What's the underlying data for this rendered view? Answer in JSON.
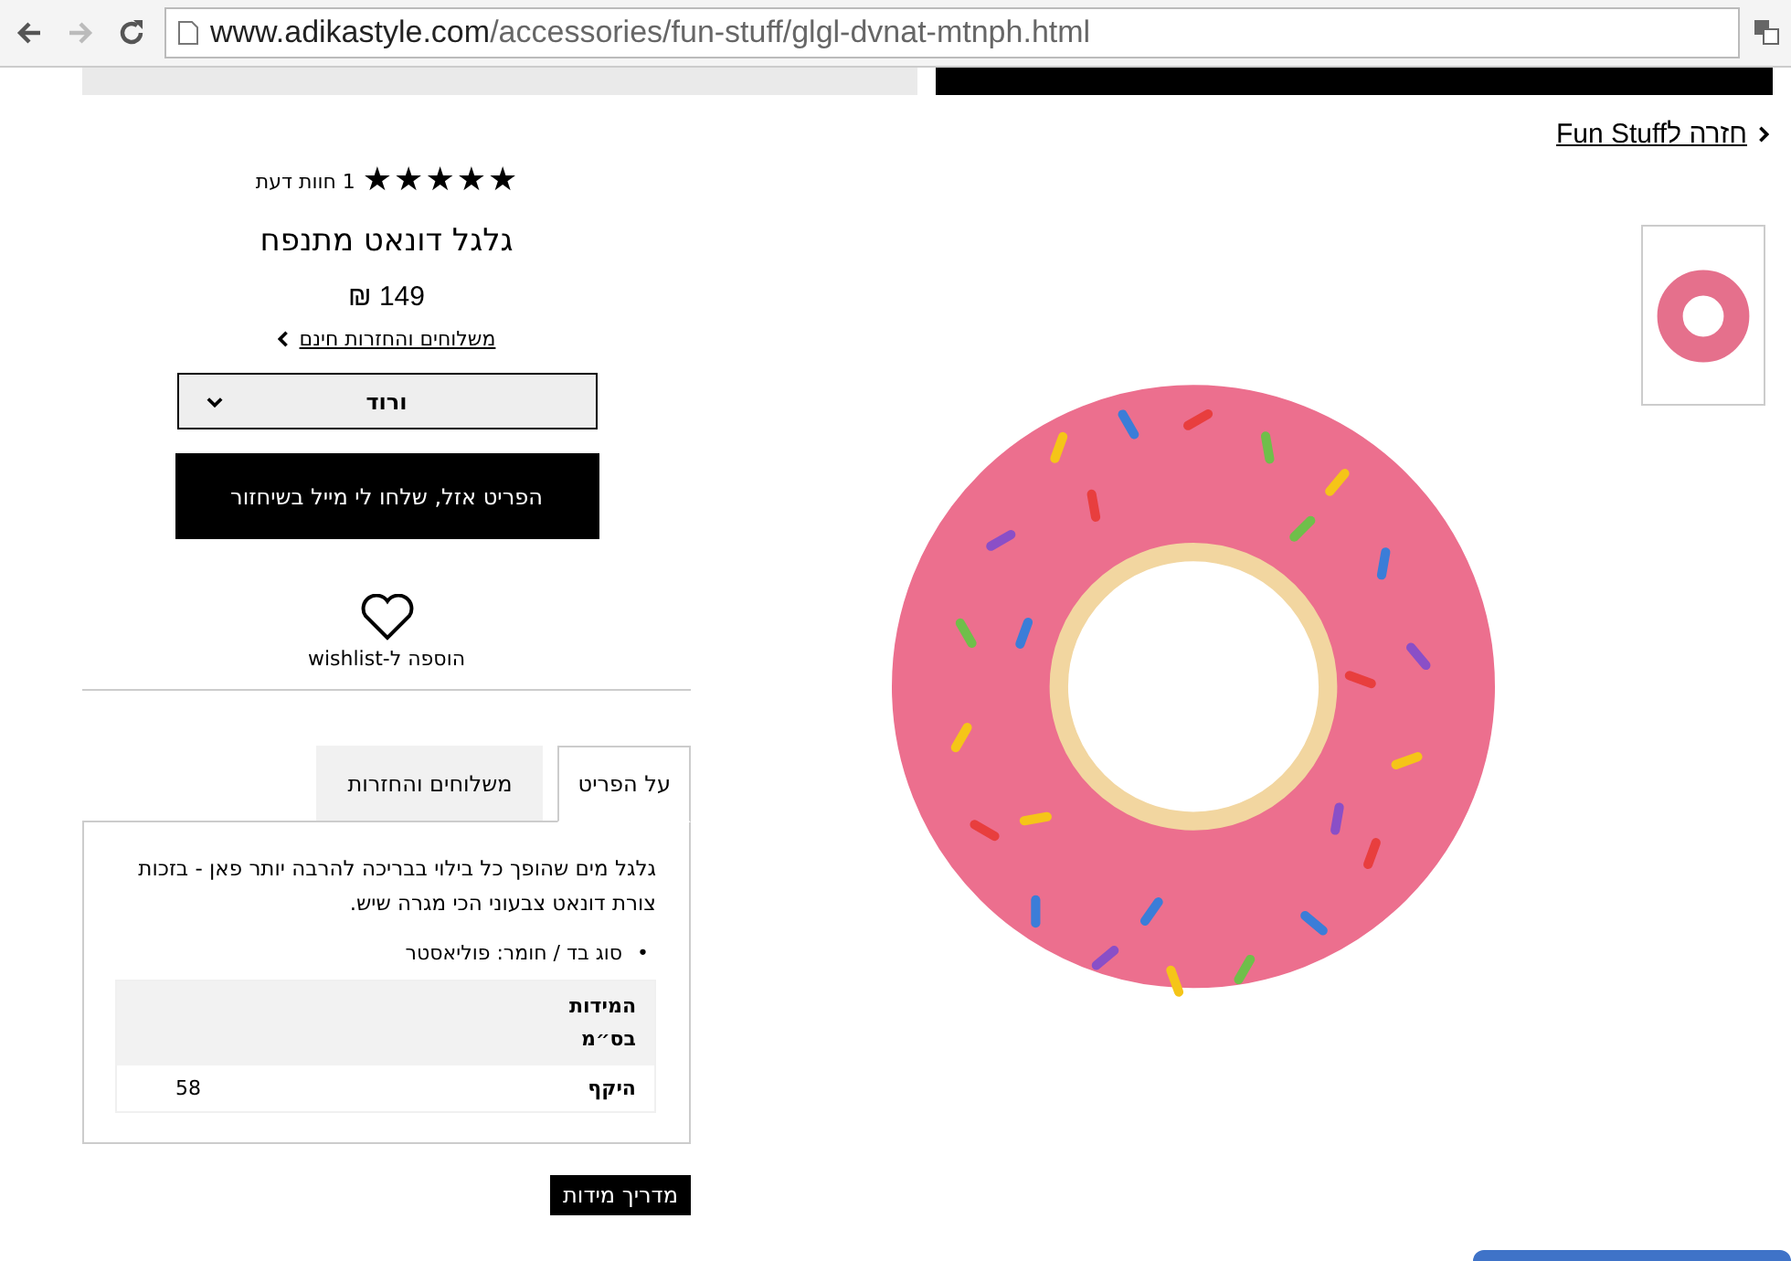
{
  "browser": {
    "url_domain": "www.adikastyle.com",
    "url_path": "/accessories/fun-stuff/glgl-dvnat-mtnph.html"
  },
  "breadcrumb": {
    "label": "חזרה לFun Stuff"
  },
  "product": {
    "stars": 5,
    "reviews": "1 חוות דעת",
    "title": "גלגל דונאט מתנפח",
    "price": "149 ₪",
    "shipping_link": "משלוחים והחזרות חינם",
    "color_select": "ורוד",
    "notify_button": "הפריט אזל, שלחו לי מייל בשיחזור",
    "wishlist": "הוספה ל-wishlist"
  },
  "tabs": [
    {
      "label": "על הפריט",
      "selected": true
    },
    {
      "label": "משלוחים והחזרות",
      "selected": false
    }
  ],
  "description": "גלגל מים שהופך כל בילוי בבריכה להרבה יותר פאן - בזכות צורת דונאט צבעוני הכי מגרה שיש.",
  "bullets": [
    {
      "marker": "•",
      "text": "סוג בד / חומר:  פוליאסטר"
    }
  ],
  "size_table": {
    "header": "המידות בס״מ",
    "rows": [
      {
        "label": "היקף",
        "value": "58"
      }
    ]
  },
  "size_guide_button": "מדריך מידות"
}
